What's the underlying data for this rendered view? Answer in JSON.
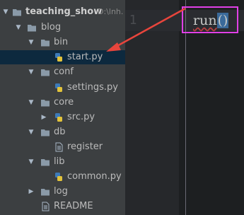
{
  "project_tree": {
    "root": {
      "name": "teaching_show",
      "path": "D:\\lnh."
    },
    "items": [
      {
        "label": "blog"
      },
      {
        "label": "bin"
      },
      {
        "label": "start.py"
      },
      {
        "label": "conf"
      },
      {
        "label": "settings.py"
      },
      {
        "label": "core"
      },
      {
        "label": "src.py"
      },
      {
        "label": "db"
      },
      {
        "label": "register"
      },
      {
        "label": "lib"
      },
      {
        "label": "common.py"
      },
      {
        "label": "log"
      },
      {
        "label": "README"
      }
    ],
    "selected": "start.py"
  },
  "editor": {
    "line_number": "1",
    "code_function": "run",
    "code_parens": "()"
  },
  "colors": {
    "panel_bg": "#3c3f41",
    "editor_bg": "#1d1f21",
    "highlight_box": "#e040e6",
    "arrow": "#e8453c",
    "folder": "#8a9aa8"
  },
  "icons": {
    "expanded": "triangle-down",
    "collapsed": "triangle-right",
    "folder": "folder-icon",
    "python_file": "python-file-icon",
    "text_file": "text-file-icon"
  }
}
